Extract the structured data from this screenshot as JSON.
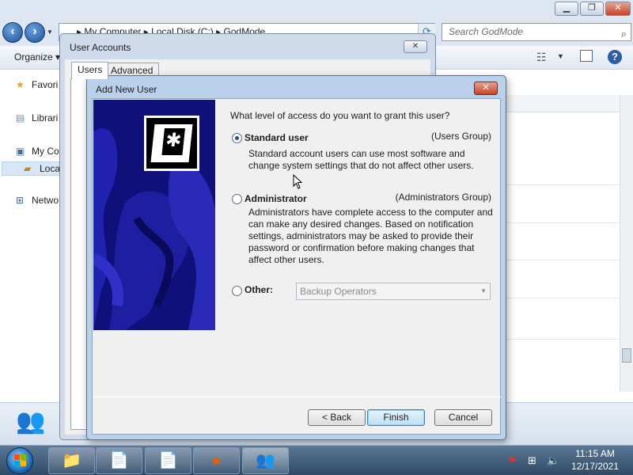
{
  "explorer": {
    "address": {
      "breadcrumb": [
        "My Computer",
        "Local Disk (C:)",
        "GodMode"
      ],
      "separator": "▸"
    },
    "search_placeholder": "Search GodMode",
    "toolbar": {
      "organize_label": "Organize"
    },
    "sidebar": {
      "items": [
        {
          "label": "Favori",
          "icon": "star-icon"
        },
        {
          "label": "Librari",
          "icon": "library-icon"
        },
        {
          "label": "My Co",
          "icon": "computer-icon"
        },
        {
          "label": "Loca",
          "icon": "drive-icon"
        },
        {
          "label": "Netwo",
          "icon": "network-icon"
        }
      ]
    }
  },
  "user_accounts": {
    "title": "User Accounts",
    "tabs": [
      "Users",
      "Advanced"
    ]
  },
  "add_user": {
    "title": "Add New User",
    "question": "What level of access do you want to grant this user?",
    "options": {
      "standard": {
        "label": "Standard user",
        "group": "(Users Group)",
        "desc": "Standard account users can use most software and change system settings that do not affect other users.",
        "selected": true
      },
      "administrator": {
        "label": "Administrator",
        "group": "(Administrators Group)",
        "desc": "Administrators have complete access to the computer and can make any desired changes. Based on notification settings, administrators may be asked to provide their password or confirmation before making changes that affect other users.",
        "selected": false
      },
      "other": {
        "label": "Other:",
        "select_value": "Backup Operators",
        "selected": false
      }
    },
    "buttons": {
      "back": "< Back",
      "finish": "Finish",
      "cancel": "Cancel"
    }
  },
  "taskbar": {
    "clock_time": "11:15 AM",
    "clock_date": "12/17/2021"
  },
  "colors": {
    "banner_bg": "#10107a",
    "dialog_frame": "#b9d1ea",
    "taskbar": "#2f4a66"
  }
}
